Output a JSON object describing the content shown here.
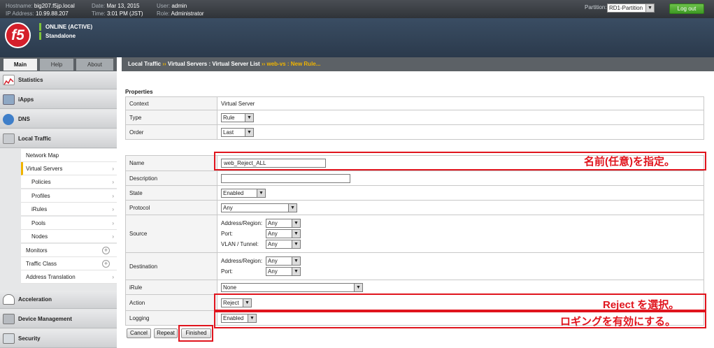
{
  "topbar": {
    "hostname_label": "Hostname:",
    "hostname": "big207.f5jp.local",
    "ip_label": "IP Address:",
    "ip": "10.99.88.207",
    "date_label": "Date:",
    "date": "Mar 13, 2015",
    "time_label": "Time:",
    "time": "3:01 PM (JST)",
    "user_label": "User:",
    "user": "admin",
    "role_label": "Role:",
    "role": "Administrator",
    "partition_label": "Partition:",
    "partition_value": "RD1-Partition",
    "logout_label": "Log out"
  },
  "banner": {
    "logo_text": "f5",
    "status_online": "ONLINE (ACTIVE)",
    "status_mode": "Standalone"
  },
  "tabs": [
    "Main",
    "Help",
    "About"
  ],
  "sidebar": {
    "sections": [
      "Statistics",
      "iApps",
      "DNS",
      "Local Traffic",
      "Acceleration",
      "Device Management",
      "Security"
    ],
    "local_traffic_items": [
      "Network Map",
      "Virtual Servers",
      "Policies",
      "Profiles",
      "iRules",
      "Pools",
      "Nodes",
      "Monitors",
      "Traffic Class",
      "Address Translation"
    ]
  },
  "breadcrumb": {
    "part1": "Local Traffic",
    "sep": "››",
    "part2": "Virtual Servers : Virtual Server List",
    "part3": "web-vs : New Rule..."
  },
  "properties": {
    "title": "Properties",
    "context_label": "Context",
    "context_value": "Virtual Server",
    "type_label": "Type",
    "type_value": "Rule",
    "order_label": "Order",
    "order_value": "Last"
  },
  "form": {
    "name_label": "Name",
    "name_value": "web_Reject_ALL",
    "description_label": "Description",
    "description_value": "",
    "state_label": "State",
    "state_value": "Enabled",
    "protocol_label": "Protocol",
    "protocol_value": "Any",
    "source_label": "Source",
    "source_addr_label": "Address/Region:",
    "source_addr_value": "Any",
    "source_port_label": "Port:",
    "source_port_value": "Any",
    "source_vlan_label": "VLAN / Tunnel:",
    "source_vlan_value": "Any",
    "dest_label": "Destination",
    "dest_addr_label": "Address/Region:",
    "dest_addr_value": "Any",
    "dest_port_label": "Port:",
    "dest_port_value": "Any",
    "irule_label": "iRule",
    "irule_value": "None",
    "action_label": "Action",
    "action_value": "Reject",
    "logging_label": "Logging",
    "logging_value": "Enabled"
  },
  "annotations": {
    "name_note": "名前(任意)を指定。",
    "action_note": "Reject を選択。",
    "logging_note": "ロギングを有効にする。"
  },
  "buttons": {
    "cancel": "Cancel",
    "repeat": "Repeat",
    "finished": "Finished"
  },
  "colors": {
    "annotation_red": "#e0141d",
    "active_accent": "#f0b400",
    "logout_green": "#4aa82c"
  }
}
